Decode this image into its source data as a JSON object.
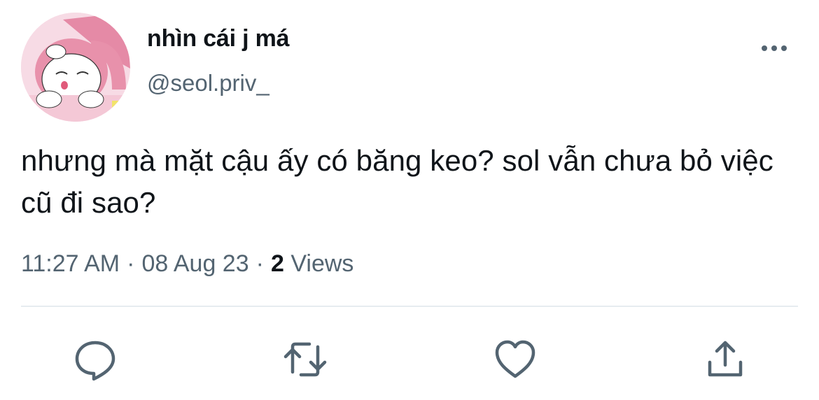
{
  "author": {
    "display_name": "nhìn cái j má",
    "handle": "@seol.priv_",
    "avatar_icon": "my-melody-avatar"
  },
  "tweet": {
    "text": "nhưng mà mặt cậu ấy có băng keo? sol vẫn chưa bỏ việc cũ đi sao?",
    "time": "11:27 AM",
    "date": "08 Aug 23",
    "separator": "·",
    "views_count": "2",
    "views_label": "Views"
  },
  "actions": [
    {
      "name": "reply",
      "icon": "comment-icon"
    },
    {
      "name": "retweet",
      "icon": "retweet-icon"
    },
    {
      "name": "like",
      "icon": "heart-icon"
    },
    {
      "name": "share",
      "icon": "share-icon"
    }
  ],
  "colors": {
    "text_primary": "#0f1419",
    "text_secondary": "#536471",
    "divider": "#e6ecf0"
  }
}
